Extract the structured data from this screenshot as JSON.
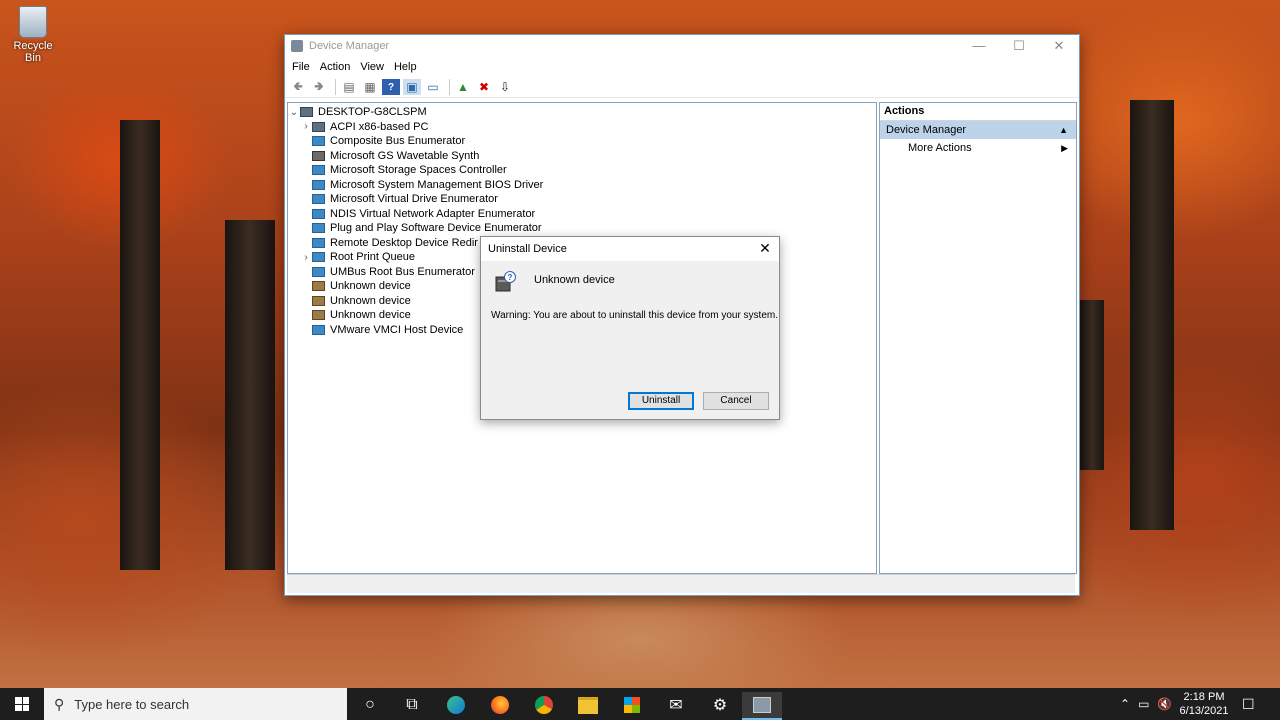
{
  "desktop": {
    "recycle_bin_label": "Recycle Bin"
  },
  "window": {
    "title": "Device Manager",
    "menu": [
      "File",
      "Action",
      "View",
      "Help"
    ],
    "tree": {
      "root": "DESKTOP-G8CLSPM",
      "items": [
        {
          "label": "ACPI x86-based PC",
          "expandable": true,
          "icon": "computer-icon"
        },
        {
          "label": "Composite Bus Enumerator",
          "expandable": false,
          "icon": "system-device-icon"
        },
        {
          "label": "Microsoft GS Wavetable Synth",
          "expandable": false,
          "icon": "audio-device-icon"
        },
        {
          "label": "Microsoft Storage Spaces Controller",
          "expandable": false,
          "icon": "storage-controller-icon"
        },
        {
          "label": "Microsoft System Management BIOS Driver",
          "expandable": false,
          "icon": "system-device-icon"
        },
        {
          "label": "Microsoft Virtual Drive Enumerator",
          "expandable": false,
          "icon": "system-device-icon"
        },
        {
          "label": "NDIS Virtual Network Adapter Enumerator",
          "expandable": false,
          "icon": "system-device-icon"
        },
        {
          "label": "Plug and Play Software Device Enumerator",
          "expandable": false,
          "icon": "system-device-icon"
        },
        {
          "label": "Remote Desktop Device Redir",
          "expandable": false,
          "icon": "system-device-icon"
        },
        {
          "label": "Root Print Queue",
          "expandable": true,
          "icon": "printer-icon"
        },
        {
          "label": "UMBus Root Bus Enumerator",
          "expandable": false,
          "icon": "system-device-icon"
        },
        {
          "label": "Unknown device",
          "expandable": false,
          "icon": "unknown-device-icon"
        },
        {
          "label": "Unknown device",
          "expandable": false,
          "icon": "unknown-device-warning-icon"
        },
        {
          "label": "Unknown device",
          "expandable": false,
          "icon": "unknown-device-warning-icon"
        },
        {
          "label": "VMware VMCI Host Device",
          "expandable": false,
          "icon": "system-device-icon"
        }
      ]
    },
    "actions": {
      "header": "Actions",
      "section": "Device Manager",
      "more": "More Actions"
    }
  },
  "dialog": {
    "title": "Uninstall Device",
    "device_name": "Unknown device",
    "warning": "Warning: You are about to uninstall this device from your system.",
    "uninstall_label": "Uninstall",
    "cancel_label": "Cancel"
  },
  "taskbar": {
    "search_placeholder": "Type here to search",
    "time": "2:18 PM",
    "date": "6/13/2021"
  },
  "colors": {
    "accent": "#0078d7",
    "actions_section_bg": "#bcd3ea",
    "taskbar_bg": "#1e1e1e"
  }
}
